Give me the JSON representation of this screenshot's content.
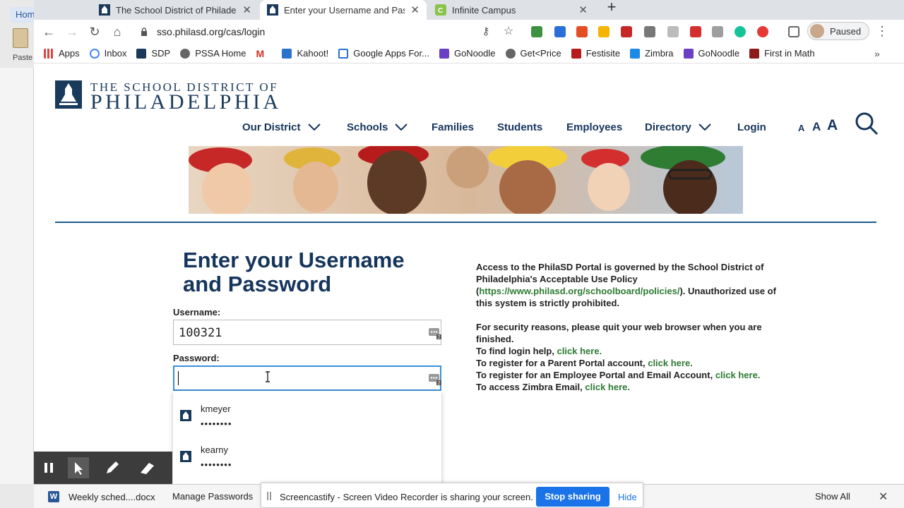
{
  "word": {
    "tab_label": "Hom",
    "paste_label": "Paste"
  },
  "browser": {
    "tabs": [
      {
        "title": "The School District of Philadelphia",
        "active": false
      },
      {
        "title": "Enter your Username and Password",
        "active": true
      },
      {
        "title": "Infinite Campus",
        "active": false
      }
    ],
    "url": "sso.philasd.org/cas/login",
    "profile_label": "Paused",
    "bookmarks": [
      "Apps",
      "Inbox",
      "SDP",
      "PSSA Home",
      "",
      "Kahoot!",
      "Google Apps For...",
      "GoNoodle",
      "Get<Price",
      "Festisite",
      "Zimbra",
      "GoNoodle",
      "First in Math"
    ]
  },
  "site": {
    "logo_line1": "THE SCHOOL DISTRICT OF",
    "logo_line2": "PHILADELPHIA",
    "nav": [
      "Our District",
      "Schools",
      "Families",
      "Students",
      "Employees",
      "Directory",
      "Login"
    ],
    "font_sizes": [
      "A",
      "A",
      "A"
    ]
  },
  "login": {
    "title": "Enter your Username and Password",
    "username_label": "Username:",
    "username_value": "100321",
    "password_label": "Password:",
    "password_value": "",
    "saved_accounts": [
      {
        "username": "kmeyer",
        "password_mask": "••••••••"
      },
      {
        "username": "kearny",
        "password_mask": "••••••••"
      }
    ],
    "manage_passwords": "Manage Passwords"
  },
  "info": {
    "policy_text": "Access to the PhilaSD Portal is governed by the School District of Philadelphia's Acceptable Use Policy (",
    "policy_link": "https://www.philasd.org/schoolboard/policies/",
    "policy_text2": "). Unauthorized use of this system is strictly prohibited.",
    "security_text": "For security reasons, please quit your web browser when you are finished.",
    "help_prefix": "To find login help,",
    "parent_prefix": "To register for a Parent Portal account,",
    "employee_prefix": "To register for an Employee Portal and Email Account,",
    "zimbra_prefix": "To access Zimbra Email,",
    "click_here": "click here."
  },
  "screencastify": {
    "message": "Screencastify - Screen Video Recorder is sharing your screen.",
    "stop_label": "Stop sharing",
    "hide_label": "Hide"
  },
  "downloads": {
    "file_name": "Weekly sched....docx",
    "show_all": "Show All"
  },
  "colors": {
    "navy": "#15355c",
    "link_green": "#2d7a32",
    "focus_blue": "#3b8fd6",
    "chrome_blue": "#1a73e8"
  }
}
